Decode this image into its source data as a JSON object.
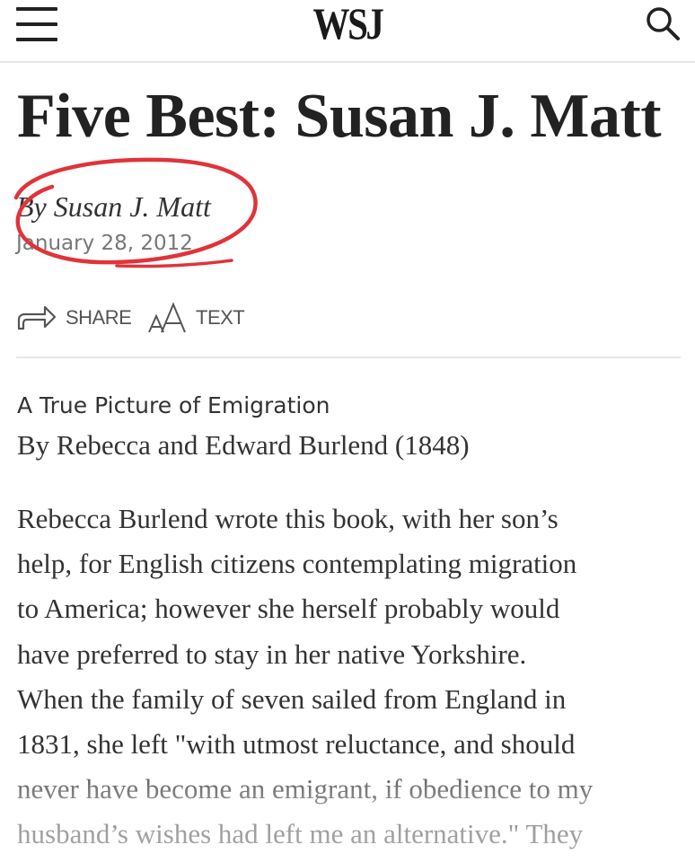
{
  "header": {
    "logo": "WSJ",
    "menu_icon": "hamburger-menu-icon",
    "search_icon": "search-icon"
  },
  "article": {
    "title": "Five Best: Susan J. Matt",
    "byline": "By Susan J. Matt",
    "date": "January 28, 2012",
    "annotation_color": "#e0333a"
  },
  "tools": {
    "share_label": "SHARE",
    "text_label": "TEXT",
    "share_icon": "share-arrow-icon",
    "text_icon": "font-size-icon"
  },
  "section": {
    "heading": "A True Picture of Emigration",
    "credit": "By Rebecca and Edward Burlend (1848)",
    "body_lines": [
      "Rebecca Burlend wrote this book, with her son’s",
      "help, for English citizens contemplating migration",
      "to America; however she herself probably would",
      "have preferred to stay in her native Yorkshire.",
      "When the family of seven sailed from England in",
      "1831, she left \"with utmost reluctance, and should",
      "never have become an emigrant, if obedience to my",
      "husband’s wishes had left me an alternative.\" They"
    ]
  }
}
